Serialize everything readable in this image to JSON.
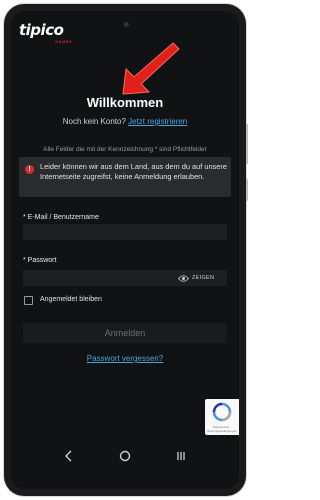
{
  "brand": {
    "name": "tipico",
    "sub": "GAMES",
    "accent_color": "#c62828",
    "link_color": "#4aa3e0",
    "arrow_color": "#e0201b"
  },
  "header": {
    "title": "Willkommen",
    "no_account_text": "Noch kein Konto?",
    "register_link": "Jetzt registrieren"
  },
  "form": {
    "required_note": "Alle Felder die mit der Kennzeichnung * sind Pflichtfelder",
    "alert_text": "Leider können wir aus dem Land, aus dem du auf unsere Internetseite zugreifst, keine Anmeldung erlauben.",
    "alert_icon": "error-icon",
    "email_label": "* E-Mail / Benutzername",
    "email_value": "",
    "password_label": "* Passwort",
    "password_value": "",
    "show_password_label": "ZEIGEN",
    "remember_label": "Angemeldet bleiben",
    "remember_checked": false,
    "login_button": "Anmelden",
    "forgot_link": "Passwort vergessen?"
  },
  "recaptcha": {
    "text": "Datenschutz - Nutzungsbedingungen"
  },
  "navbar": {
    "icons": [
      "back-icon",
      "home-icon",
      "recents-icon"
    ]
  }
}
